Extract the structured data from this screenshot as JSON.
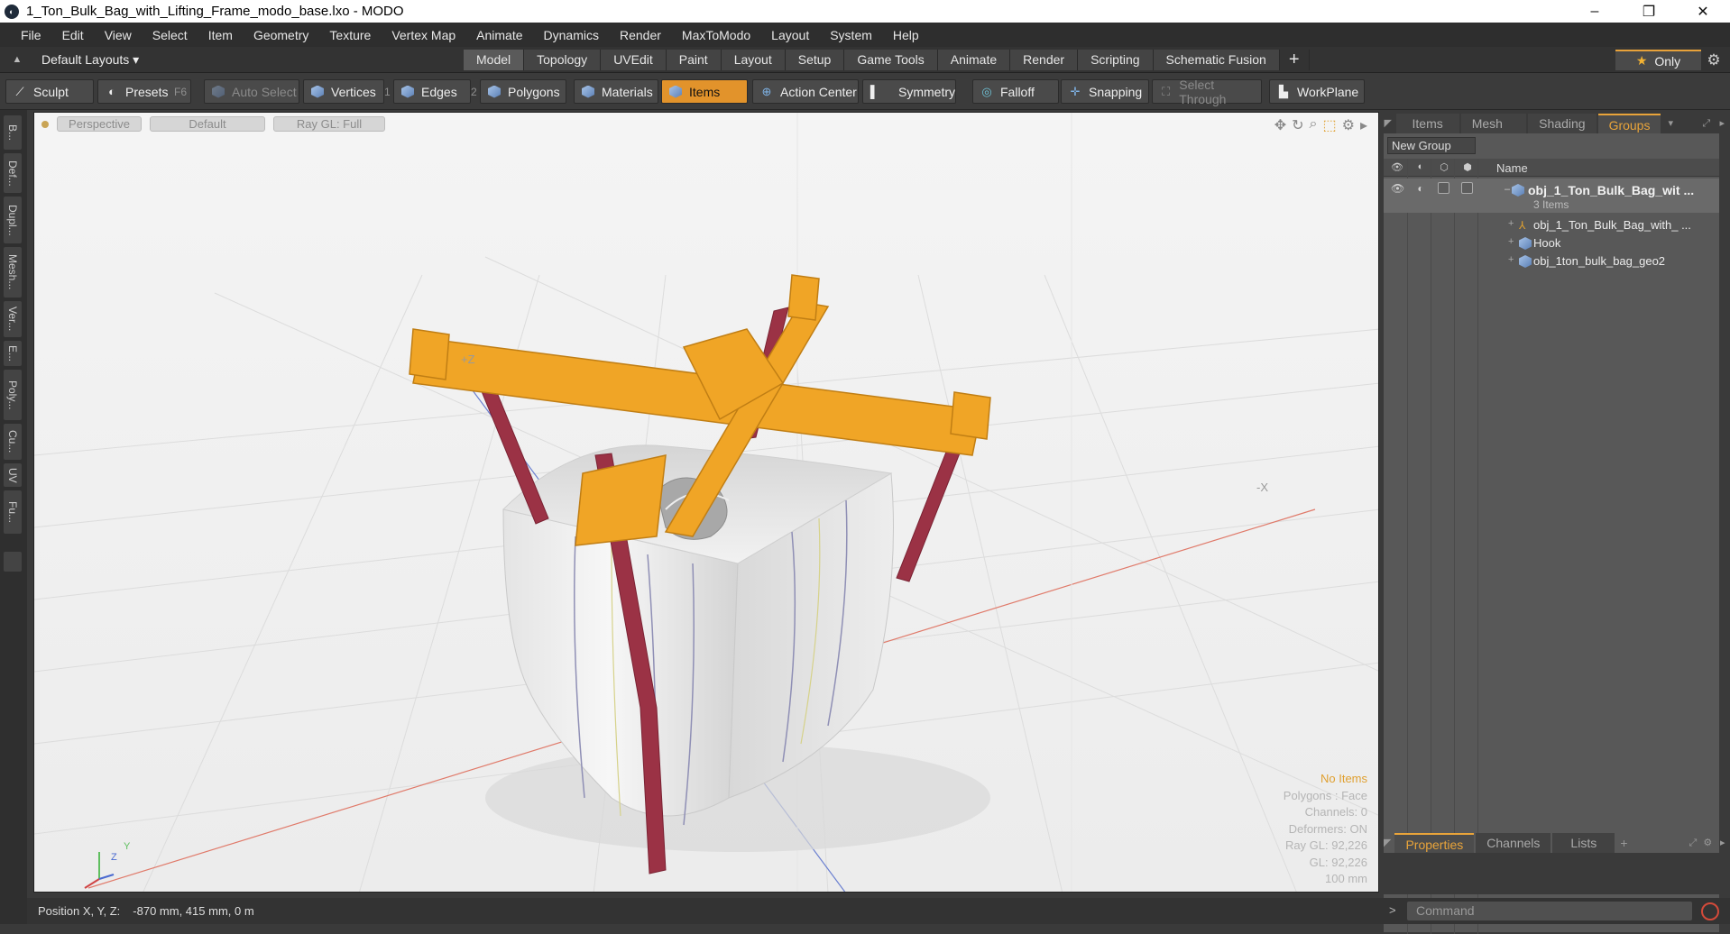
{
  "window": {
    "title": "1_Ton_Bulk_Bag_with_Lifting_Frame_modo_base.lxo - MODO",
    "minimize": "–",
    "restore": "❐",
    "close": "✕"
  },
  "menu": [
    "File",
    "Edit",
    "View",
    "Select",
    "Item",
    "Geometry",
    "Texture",
    "Vertex Map",
    "Animate",
    "Dynamics",
    "Render",
    "MaxToModo",
    "Layout",
    "System",
    "Help"
  ],
  "layouts": {
    "label": "Default Layouts ▾"
  },
  "mode_tabs": [
    "Model",
    "Topology",
    "UVEdit",
    "Paint",
    "Layout",
    "Setup",
    "Game Tools",
    "Animate",
    "Render",
    "Scripting",
    "Schematic Fusion"
  ],
  "mode_tab_plus": "+",
  "only_label": "Only",
  "toolbar": {
    "sculpt": "Sculpt",
    "presets": "Presets",
    "presets_key": "F6",
    "auto_select": "Auto Select",
    "vertices": "Vertices",
    "vertices_num": "1",
    "edges": "Edges",
    "edges_num": "2",
    "polygons": "Polygons",
    "materials": "Materials",
    "items": "Items",
    "action_center": "Action Center",
    "symmetry": "Symmetry",
    "falloff": "Falloff",
    "snapping": "Snapping",
    "select_through": "Select Through",
    "workplane": "WorkPlane"
  },
  "left_tabs": [
    "B...",
    "Def...",
    "Dupl...",
    "Mesh...",
    "Ver...",
    "E...",
    "Poly...",
    "Cu...",
    "UV",
    "Fu..."
  ],
  "viewport": {
    "view": "Perspective",
    "style": "Default",
    "render": "Ray GL: Full",
    "axis_z": "+Z",
    "axis_x": "-X",
    "stats": {
      "no_items": "No Items",
      "polygons": "Polygons : Face",
      "channels": "Channels: 0",
      "deformers": "Deformers: ON",
      "raygl": "Ray GL: 92,226",
      "gl": "GL: 92,226",
      "scale": "100 mm"
    },
    "gizmo_y": "Y",
    "gizmo_z": "Z"
  },
  "status": {
    "label": "Position X, Y, Z:",
    "value": "-870 mm, 415 mm, 0 m"
  },
  "right_panel": {
    "tabs": [
      "Items",
      "Mesh ...",
      "Shading",
      "Groups"
    ],
    "new_group": "New Group",
    "name_header": "Name",
    "group": {
      "name": "obj_1_Ton_Bulk_Bag_wit ...",
      "count": "3 Items"
    },
    "children": [
      "obj_1_Ton_Bulk_Bag_with_ ...",
      "Hook",
      "obj_1ton_bulk_bag_geo2"
    ],
    "bottom_tabs": [
      "Properties",
      "Channels",
      "Lists"
    ],
    "bottom_plus": "+",
    "command_placeholder": "Command",
    "prompt": ">"
  }
}
